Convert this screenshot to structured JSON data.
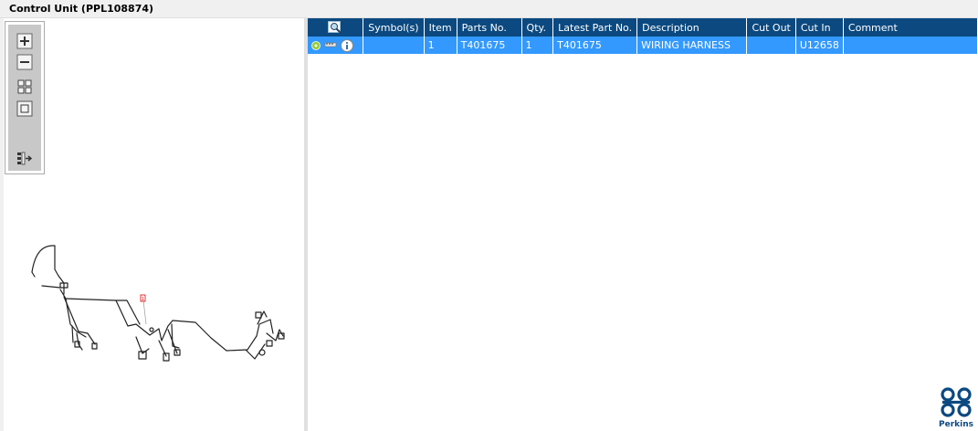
{
  "window": {
    "title": "Control Unit (PPL108874)"
  },
  "toolbar": {
    "icons": [
      "zoom-in-icon",
      "zoom-out-icon",
      "fit-page-icon",
      "actual-size-icon",
      "toggle-list-icon"
    ]
  },
  "diagram": {
    "callout_label": "1"
  },
  "table": {
    "columns": [
      "Symbol(s)",
      "Item",
      "Parts No.",
      "Qty.",
      "Latest Part No.",
      "Description",
      "Cut Out",
      "Cut In",
      "Comment"
    ],
    "rows": [
      {
        "symbols": "",
        "item": "1",
        "parts_no": "T401675",
        "qty": "1",
        "latest_part_no": "T401675",
        "description": "WIRING HARNESS",
        "cut_out": "",
        "cut_in": "U12658",
        "comment": ""
      }
    ]
  },
  "brand": {
    "name": "Perkins",
    "color": "#0b4980"
  },
  "colors": {
    "header": "#0b4980",
    "selected_row": "#3399ff"
  }
}
